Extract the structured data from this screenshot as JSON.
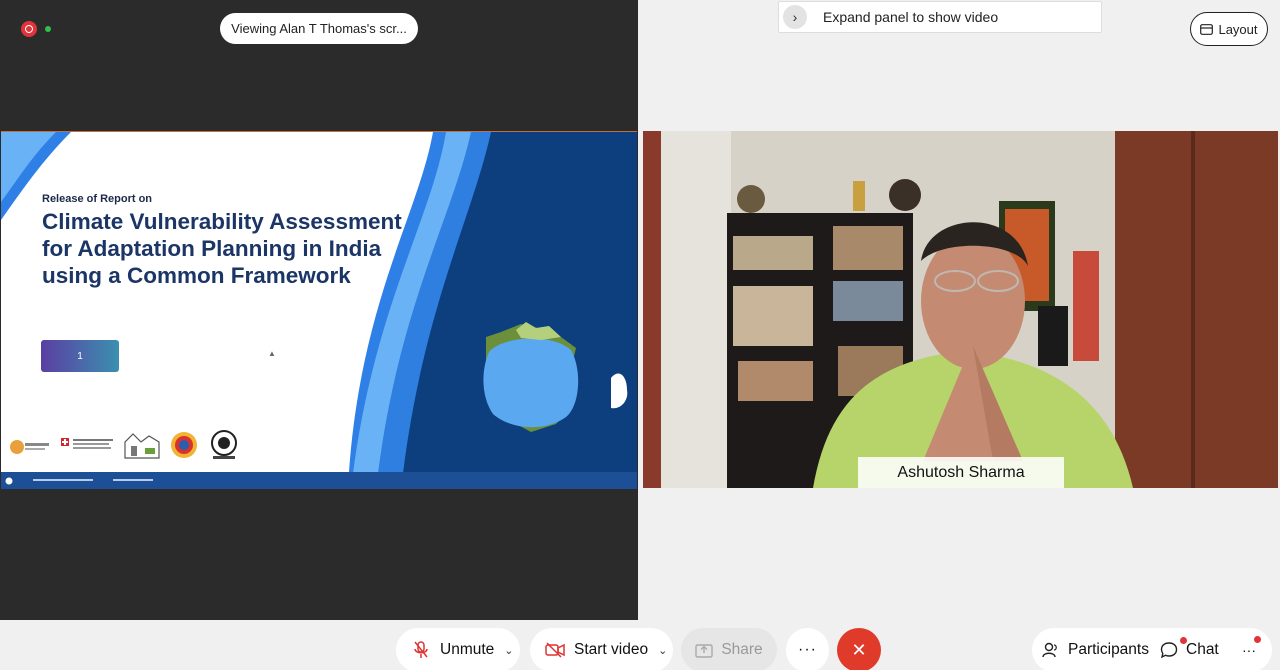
{
  "share": {
    "viewing_label": "Viewing Alan T Thomas's scr..."
  },
  "slide": {
    "kicker": "Release of Report on",
    "title": "Climate Vulnerability Assessment for Adaptation Planning in India using a Common Framework",
    "badge": "1"
  },
  "video_panel": {
    "expand_label": "Expand panel to show video",
    "layout_label": "Layout",
    "participant_name": "Ashutosh Sharma"
  },
  "toolbar": {
    "unmute_label": "Unmute",
    "start_video_label": "Start video",
    "share_label": "Share",
    "more_label": "···",
    "participants_label": "Participants",
    "chat_label": "Chat",
    "overflow_label": "···"
  },
  "colors": {
    "end_call": "#e03a2b",
    "record": "#e0343a",
    "slide_navy": "#0d3f7f",
    "slide_blue": "#4a9ef0"
  }
}
